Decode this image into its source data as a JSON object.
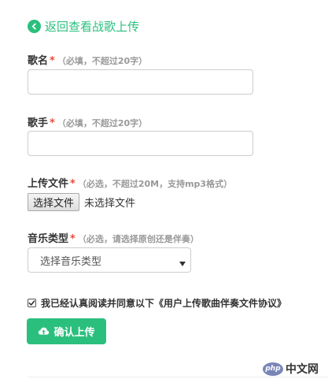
{
  "back_link": {
    "label": "返回查看战歌上传"
  },
  "fields": {
    "song_name": {
      "label": "歌名",
      "required_mark": "*",
      "hint": "（必填，不超过20字）",
      "value": ""
    },
    "singer": {
      "label": "歌手",
      "required_mark": "*",
      "hint": "（必填，不超过20字）",
      "value": ""
    },
    "upload_file": {
      "label": "上传文件",
      "required_mark": "*",
      "hint": "（必选，不超过20M，支持mp3格式）",
      "button_label": "选择文件",
      "status": "未选择文件"
    },
    "music_type": {
      "label": "音乐类型",
      "required_mark": "*",
      "hint": "（必选，请选择原创还是伴奏）",
      "selected": "选择音乐类型"
    }
  },
  "agreement": {
    "checked": true,
    "text": "我已经认真阅读并同意以下《用户上传歌曲伴奏文件协议》"
  },
  "confirm_button": {
    "label": "确认上传"
  },
  "watermark": {
    "logo": "php",
    "text": "中文网"
  },
  "colors": {
    "accent": "#2bbf7e",
    "required": "#e74c3c",
    "hint": "#999999"
  }
}
